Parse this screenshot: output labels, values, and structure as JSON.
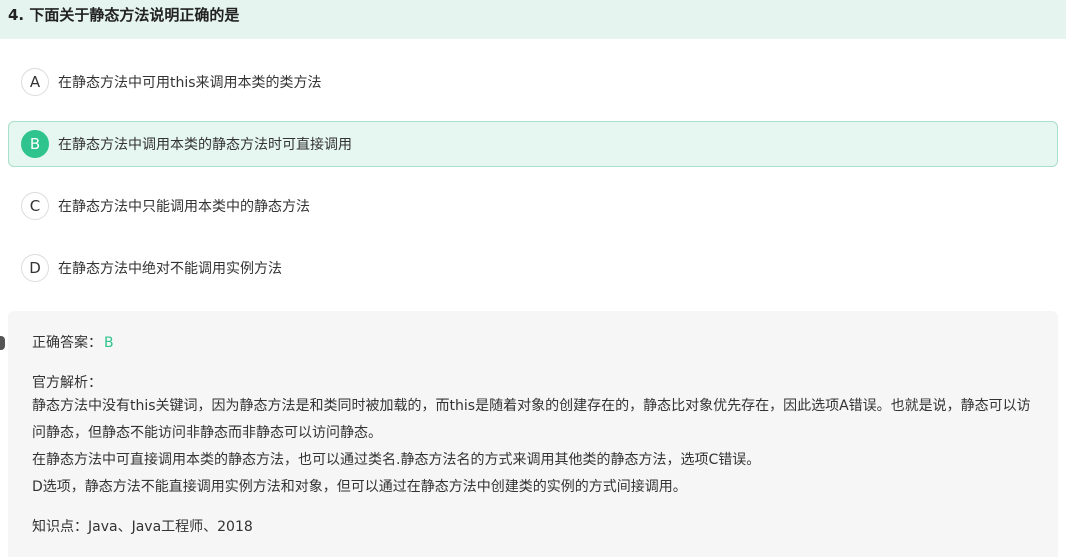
{
  "question": {
    "title": "4. 下面关于静态方法说明正确的是"
  },
  "options": [
    {
      "letter": "A",
      "text": "在静态方法中可用this来调用本类的类方法"
    },
    {
      "letter": "B",
      "text": "在静态方法中调用本类的静态方法时可直接调用"
    },
    {
      "letter": "C",
      "text": "在静态方法中只能调用本类中的静态方法"
    },
    {
      "letter": "D",
      "text": "在静态方法中绝对不能调用实例方法"
    }
  ],
  "selected_option": "B",
  "answer": {
    "label": "正确答案：",
    "value": "B"
  },
  "analysis": {
    "title": "官方解析：",
    "lines": [
      "静态方法中没有this关键词，因为静态方法是和类同时被加载的，而this是随着对象的创建存在的，静态比对象优先存在，因此选项A错误。也就是说，静态可以访问静态，但静态不能访问非静态而非静态可以访问静态。",
      "在静态方法中可直接调用本类的静态方法，也可以通过类名.静态方法名的方式来调用其他类的静态方法，选项C错误。",
      "D选项，静态方法不能直接调用实例方法和对象，但可以通过在静态方法中创建类的实例的方式间接调用。"
    ]
  },
  "knowledge_points": "知识点：Java、Java工程师、2018",
  "colors": {
    "accent": "#2fc48d",
    "header_bg": "#e6f4ef",
    "selected_bg": "#e6f6f0",
    "panel_bg": "#f6f6f6"
  }
}
